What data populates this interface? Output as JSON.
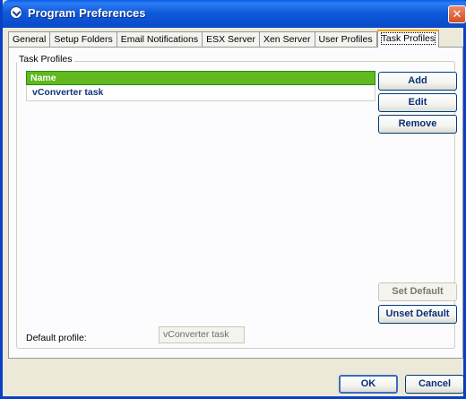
{
  "window": {
    "title": "Program Preferences",
    "close_glyph": "✕"
  },
  "tabs": [
    {
      "label": "General"
    },
    {
      "label": "Setup Folders"
    },
    {
      "label": "Email Notifications"
    },
    {
      "label": "ESX Server"
    },
    {
      "label": "Xen Server"
    },
    {
      "label": "User Profiles"
    },
    {
      "label": "Task Profiles",
      "active": true
    }
  ],
  "task_profiles": {
    "group_title": "Task Profiles",
    "list_header": "Name",
    "rows": [
      "vConverter task"
    ],
    "buttons": {
      "add": "Add",
      "edit": "Edit",
      "remove": "Remove",
      "set_default": "Set Default",
      "unset_default": "Unset Default"
    },
    "default_profile_label": "Default profile:",
    "default_profile_value": "vConverter task"
  },
  "footer": {
    "ok": "OK",
    "cancel": "Cancel"
  },
  "colors": {
    "title_bar": "#0b4fd0",
    "list_header": "#5fb91f",
    "active_tab_accent": "#f2a300"
  },
  "icons": {
    "app": "app-badge-icon",
    "close": "close-icon"
  }
}
